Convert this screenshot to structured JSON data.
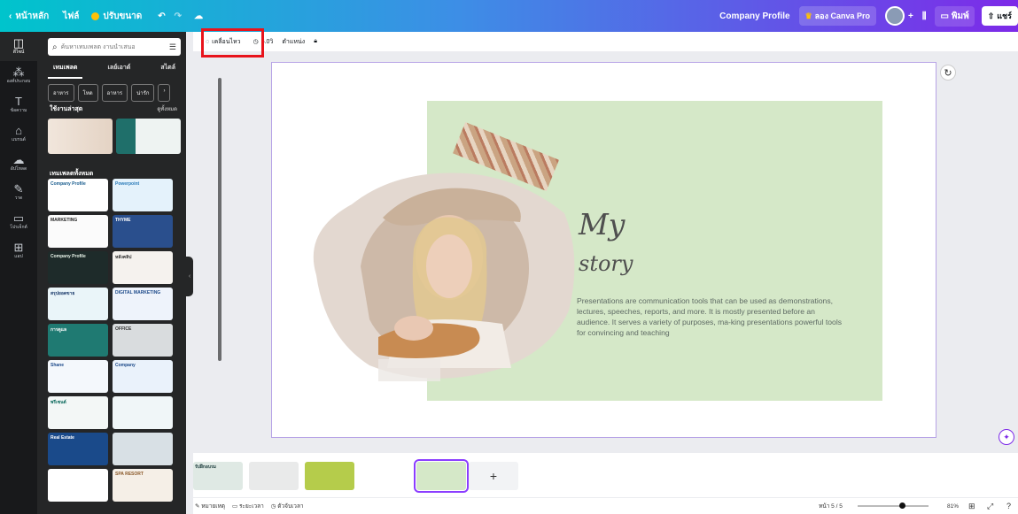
{
  "topbar": {
    "home": "หน้าหลัก",
    "file": "ไฟล์",
    "resize": "ปรับขนาด",
    "doc_title": "Company Profile",
    "try_pro": "ลอง Canva Pro",
    "print": "พิมพ์",
    "share": "แชร์"
  },
  "rail": [
    {
      "icon": "layout-icon",
      "label": "ดีไซน์"
    },
    {
      "icon": "elements-icon",
      "label": "องค์ประกอบ"
    },
    {
      "icon": "text-icon",
      "label": "ข้อความ"
    },
    {
      "icon": "brand-icon",
      "label": "แบรนด์"
    },
    {
      "icon": "upload-icon",
      "label": "อัปโหลด"
    },
    {
      "icon": "draw-icon",
      "label": "วาด"
    },
    {
      "icon": "folder-icon",
      "label": "โปรเจ็กต์"
    },
    {
      "icon": "apps-icon",
      "label": "แอป"
    }
  ],
  "panel": {
    "search_placeholder": "ค้นหาเทมเพลต งานนำเสนอ",
    "tabs": [
      "เทมเพลต",
      "เลย์เอาต์",
      "สไตล์"
    ],
    "chips": [
      "อาหาร",
      "โหด",
      "อาหาร",
      "น่ารัก"
    ],
    "recent_title": "ใช้งานล่าสุด",
    "see_all": "ดูทั้งหมด",
    "all_title": "เทมเพลตทั้งหมด",
    "templates": [
      {
        "label": "Company Profile",
        "bg": "#ffffff",
        "fg": "#1b5e8f"
      },
      {
        "label": "Powerpoint",
        "bg": "#e4f2fb",
        "fg": "#2a7bb8"
      },
      {
        "label": "MARKETING",
        "bg": "#fbfbfb",
        "fg": "#222"
      },
      {
        "label": "THYME",
        "bg": "#2a4f8d",
        "fg": "#ffffff"
      },
      {
        "label": "Company Profile",
        "bg": "#1e2b2a",
        "fg": "#e8f3e8"
      },
      {
        "label": "หลังคลิป",
        "bg": "#f5f2ee",
        "fg": "#333"
      },
      {
        "label": "สรุปยอดขาย",
        "bg": "#eaf5f9",
        "fg": "#1a3a6b"
      },
      {
        "label": "DIGITAL MARKETING",
        "bg": "#eef3fb",
        "fg": "#1d4a8a"
      },
      {
        "label": "การดูแล",
        "bg": "#1f7a72",
        "fg": "#ffffff"
      },
      {
        "label": "OFFICE",
        "bg": "#d9dcde",
        "fg": "#333"
      },
      {
        "label": "Shane",
        "bg": "#f4f8fc",
        "fg": "#1d4a8a"
      },
      {
        "label": "Company",
        "bg": "#eaf2fb",
        "fg": "#1d4a8a"
      },
      {
        "label": "พรีเซนต์",
        "bg": "#f3f7f6",
        "fg": "#0d6b5e"
      },
      {
        "label": "",
        "bg": "#f0f6f8",
        "fg": "#333"
      },
      {
        "label": "Real Estate",
        "bg": "#1a4a8a",
        "fg": "#ffffff"
      },
      {
        "label": "",
        "bg": "#d8e0e5",
        "fg": "#333"
      },
      {
        "label": "",
        "bg": "#ffffff",
        "fg": "#333"
      },
      {
        "label": "SPA RESORT",
        "bg": "#f5efe7",
        "fg": "#8b5a2b"
      }
    ]
  },
  "canvas_toolbar": {
    "animate": "เคลื่อนไหว",
    "duration": "5.0วิ",
    "position": "ตำแหน่ง"
  },
  "slide": {
    "heading_1": "My",
    "heading_2": "story",
    "body": "Presentations are communication tools that can be used as demonstrations, lectures, speeches, reports, and more. It is mostly presented before an audience. It serves a variety of purposes, ma-king presentations powerful tools for convincing and teaching"
  },
  "filmstrip": {
    "thumbs": [
      {
        "label": "รับฝึกอบรม",
        "bg": "#dfe9e4"
      },
      {
        "label": "",
        "bg": "#e9eaea"
      },
      {
        "label": "",
        "bg": "#b5cc4b"
      },
      {
        "label": "",
        "bg": "#ffffff"
      },
      {
        "label": "",
        "bg": "#d5e8c8"
      }
    ]
  },
  "bottom": {
    "notes": "หมายเหตุ",
    "timer": "ระยะเวลา",
    "timer_2": "ตัวจับเวลา",
    "page_info": "หน้า 5 / 5",
    "zoom": "81%"
  },
  "colors": {
    "accent": "#7d2ae8",
    "teal": "#00c4cc",
    "slide_green": "#d5e8c8",
    "highlight": "#e8141c"
  }
}
